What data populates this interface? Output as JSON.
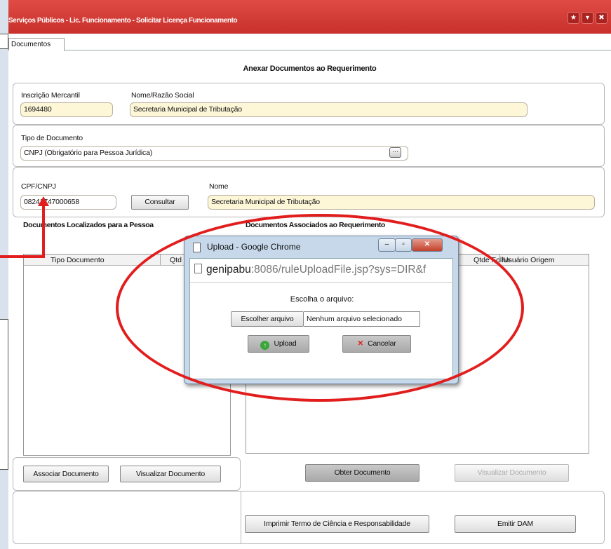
{
  "window": {
    "title": "Serviços Públicos - Lic. Funcionamento - Solicitar Licença Funcionamento",
    "buttons": [
      "★",
      "▾",
      "✖"
    ]
  },
  "tabs": [
    "Documentos"
  ],
  "form": {
    "heading": "Anexar Documentos ao Requerimento",
    "inscricao_label": "Inscrição Mercantil",
    "inscricao_value": "1694480",
    "nome_razao_label": "Nome/Razão Social",
    "nome_razao_value": "Secretaria Municipal de Tributação",
    "tipo_doc_label": "Tipo de Documento",
    "tipo_doc_value": "CNPJ (Obrigatório para Pessoa Jurídica)",
    "cpf_label": "CPF/CNPJ",
    "cpf_value": "08241747000658",
    "consultar_label": "Consultar",
    "nome_label": "Nome",
    "nome_value": "Secretaria Municipal de Tributação"
  },
  "left_section": {
    "title": "Documentos  Localizados para a Pessoa",
    "columns": [
      "Tipo Documento",
      "Qtd"
    ],
    "associar_label": "Associar Documento",
    "visualizar_label": "Visualizar Documento"
  },
  "right_section": {
    "title": "Documentos Associados ao Requerimento",
    "columns": [
      "Qtde Folha",
      "Usuário Origem"
    ],
    "obter_label": "Obter Documento",
    "visualizar_label": "Visualizar Documento"
  },
  "footer": {
    "imprimir_label": "Imprimir Termo de Ciência e Responsabilidade",
    "emitir_label": "Emitir DAM"
  },
  "dialog": {
    "title": "Upload - Google Chrome",
    "url_host": "genipabu",
    "url_rest": ":8086/ruleUploadFile.jsp?sys=DIR&f",
    "prompt": "Escolha o arquivo:",
    "choose_label": "Escolher arquivo",
    "no_file_label": "Nenhum arquivo selecionado",
    "upload_label": "Upload",
    "cancel_label": "Cancelar"
  },
  "colors": {
    "titlebar": "#d23b35",
    "annotation_red": "#e21d1d",
    "field_bg": "#fdf7d8"
  }
}
